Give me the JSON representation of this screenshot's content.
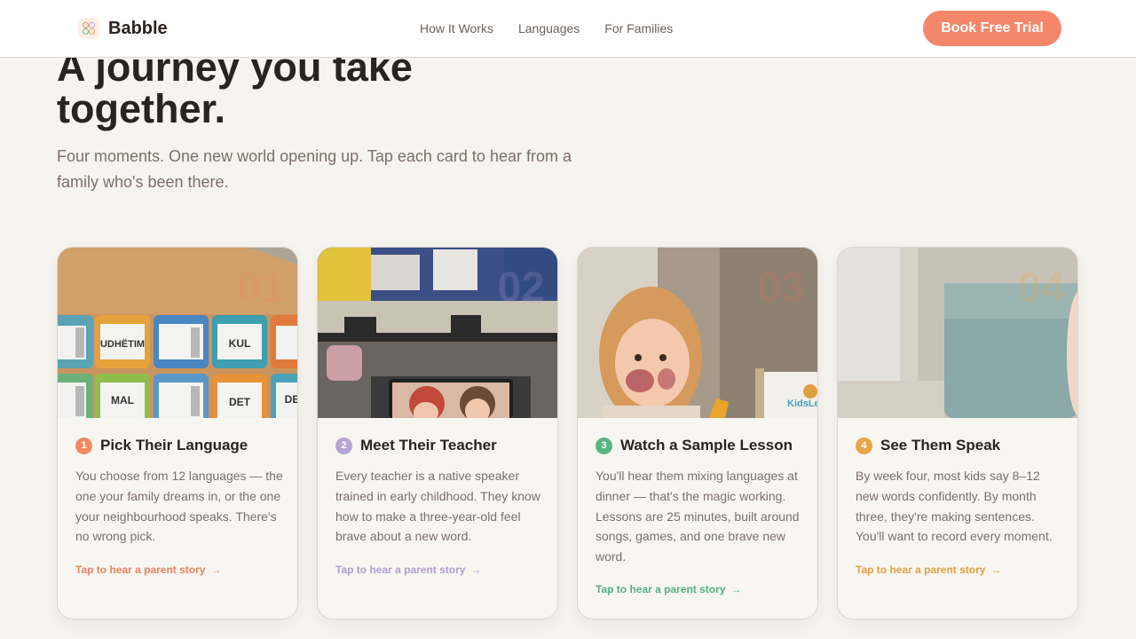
{
  "header": {
    "brand": "Babble",
    "nav": [
      "How It Works",
      "Languages",
      "For Families"
    ],
    "cta": "Book Free Trial"
  },
  "hero": {
    "title": "A journey you take together.",
    "subtitle": "Four moments. One new world opening up. Tap each card to hear from a family who's been there."
  },
  "photo_text": {
    "tiles": [
      "UDHËTIM",
      "KUL",
      "MAL",
      "DET",
      "DE"
    ],
    "tablet_brand": "KidsLe"
  },
  "cards": [
    {
      "num": "1",
      "photo_num": "01",
      "color": "#f08a63",
      "title": "Pick Their Language",
      "body": "You choose from 12 languages — the one your family dreams in, or the one your neighbourhood speaks. There's no wrong pick.",
      "link": "Tap to hear a parent story",
      "icon": "arrow-right-icon"
    },
    {
      "num": "2",
      "photo_num": "02",
      "color": "#b7a3d4",
      "title": "Meet Their Teacher",
      "body": "Every teacher is a native speaker trained in early childhood. They know how to make a three-year-old feel brave about a new word.",
      "link": "Tap to hear a parent story",
      "icon": "arrow-right-icon"
    },
    {
      "num": "3",
      "photo_num": "03",
      "color": "#5ab585",
      "title": "Watch a Sample Lesson",
      "body": "You'll hear them mixing languages at dinner — that's the magic working. Lessons are 25 minutes, built around songs, games, and one brave new word.",
      "link": "Tap to hear a parent story",
      "icon": "arrow-right-icon"
    },
    {
      "num": "4",
      "photo_num": "04",
      "color": "#e8a545",
      "title": "See Them Speak",
      "body": "By week four, most kids say 8–12 new words confidently. By month three, they're making sentences. You'll want to record every moment.",
      "link": "Tap to hear a parent story",
      "icon": "arrow-right-icon"
    }
  ]
}
